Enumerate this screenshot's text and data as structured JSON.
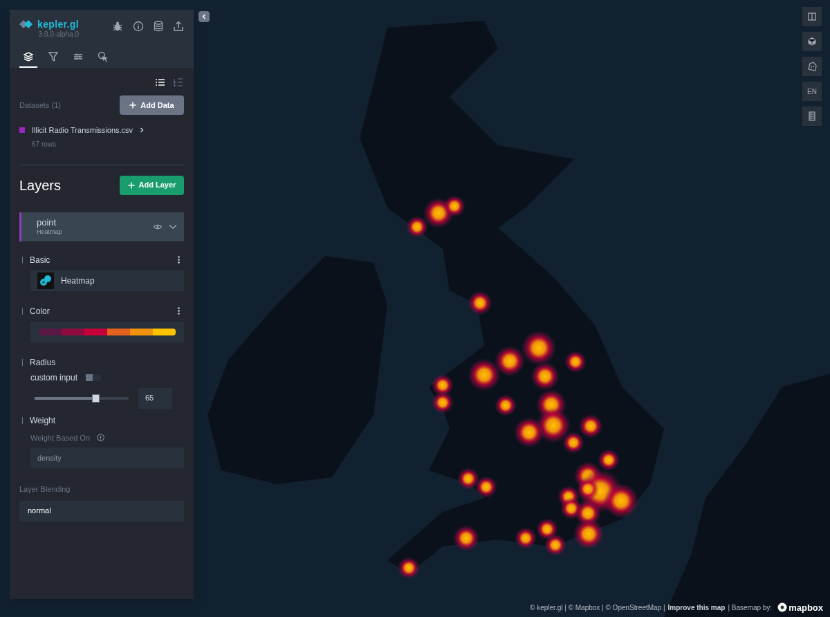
{
  "app": {
    "logo": "kepler.gl",
    "version": "3.0.0-alpha.0"
  },
  "tabs": [
    {
      "kind": "layers",
      "selected": true
    },
    {
      "kind": "filters",
      "selected": false
    },
    {
      "kind": "interactions",
      "selected": false
    },
    {
      "kind": "tooltip",
      "selected": false
    }
  ],
  "view_modes": [
    {
      "kind": "list",
      "selected": true
    },
    {
      "kind": "tree",
      "selected": false
    }
  ],
  "datasets": {
    "title": "Datasets (1)",
    "add_button": "Add Data",
    "items": [
      {
        "name": "Illicit Radio Transmissions.csv",
        "rows": "67 rows",
        "color": "#9b27c4"
      }
    ]
  },
  "layers": {
    "title": "Layers",
    "add_button": "Add Layer",
    "items": [
      {
        "name": "point",
        "type": "Heatmap",
        "color": "#8e3fc0"
      }
    ]
  },
  "layer_config": {
    "basic": {
      "label": "Basic",
      "layer_type": "Heatmap"
    },
    "color": {
      "label": "Color",
      "palette": [
        {
          "color": "#5a1846"
        },
        {
          "color": "#900c3f"
        },
        {
          "color": "#c70039"
        },
        {
          "color": "#e3611c"
        },
        {
          "color": "#f1920e"
        },
        {
          "color": "#ffc300"
        }
      ]
    },
    "radius": {
      "label": "Radius",
      "custom_input_label": "custom input",
      "custom_input": false,
      "level": 0.65,
      "value": "65"
    },
    "weight": {
      "label": "Weight",
      "field_label": "Weight Based On",
      "value": "density"
    }
  },
  "blending": {
    "label": "Layer Blending",
    "value": "normal"
  },
  "map_controls": [
    {
      "kind": "split"
    },
    {
      "kind": "perspective"
    },
    {
      "kind": "draw"
    },
    {
      "kind": "locale",
      "label": "EN"
    },
    {
      "kind": "legend"
    }
  ],
  "attribution": {
    "text": "© kepler.gl | © Mapbox | © OpenStreetMap |",
    "link": "Improve this map",
    "suffix": "| Basemap by:",
    "logo": "mapbox"
  }
}
